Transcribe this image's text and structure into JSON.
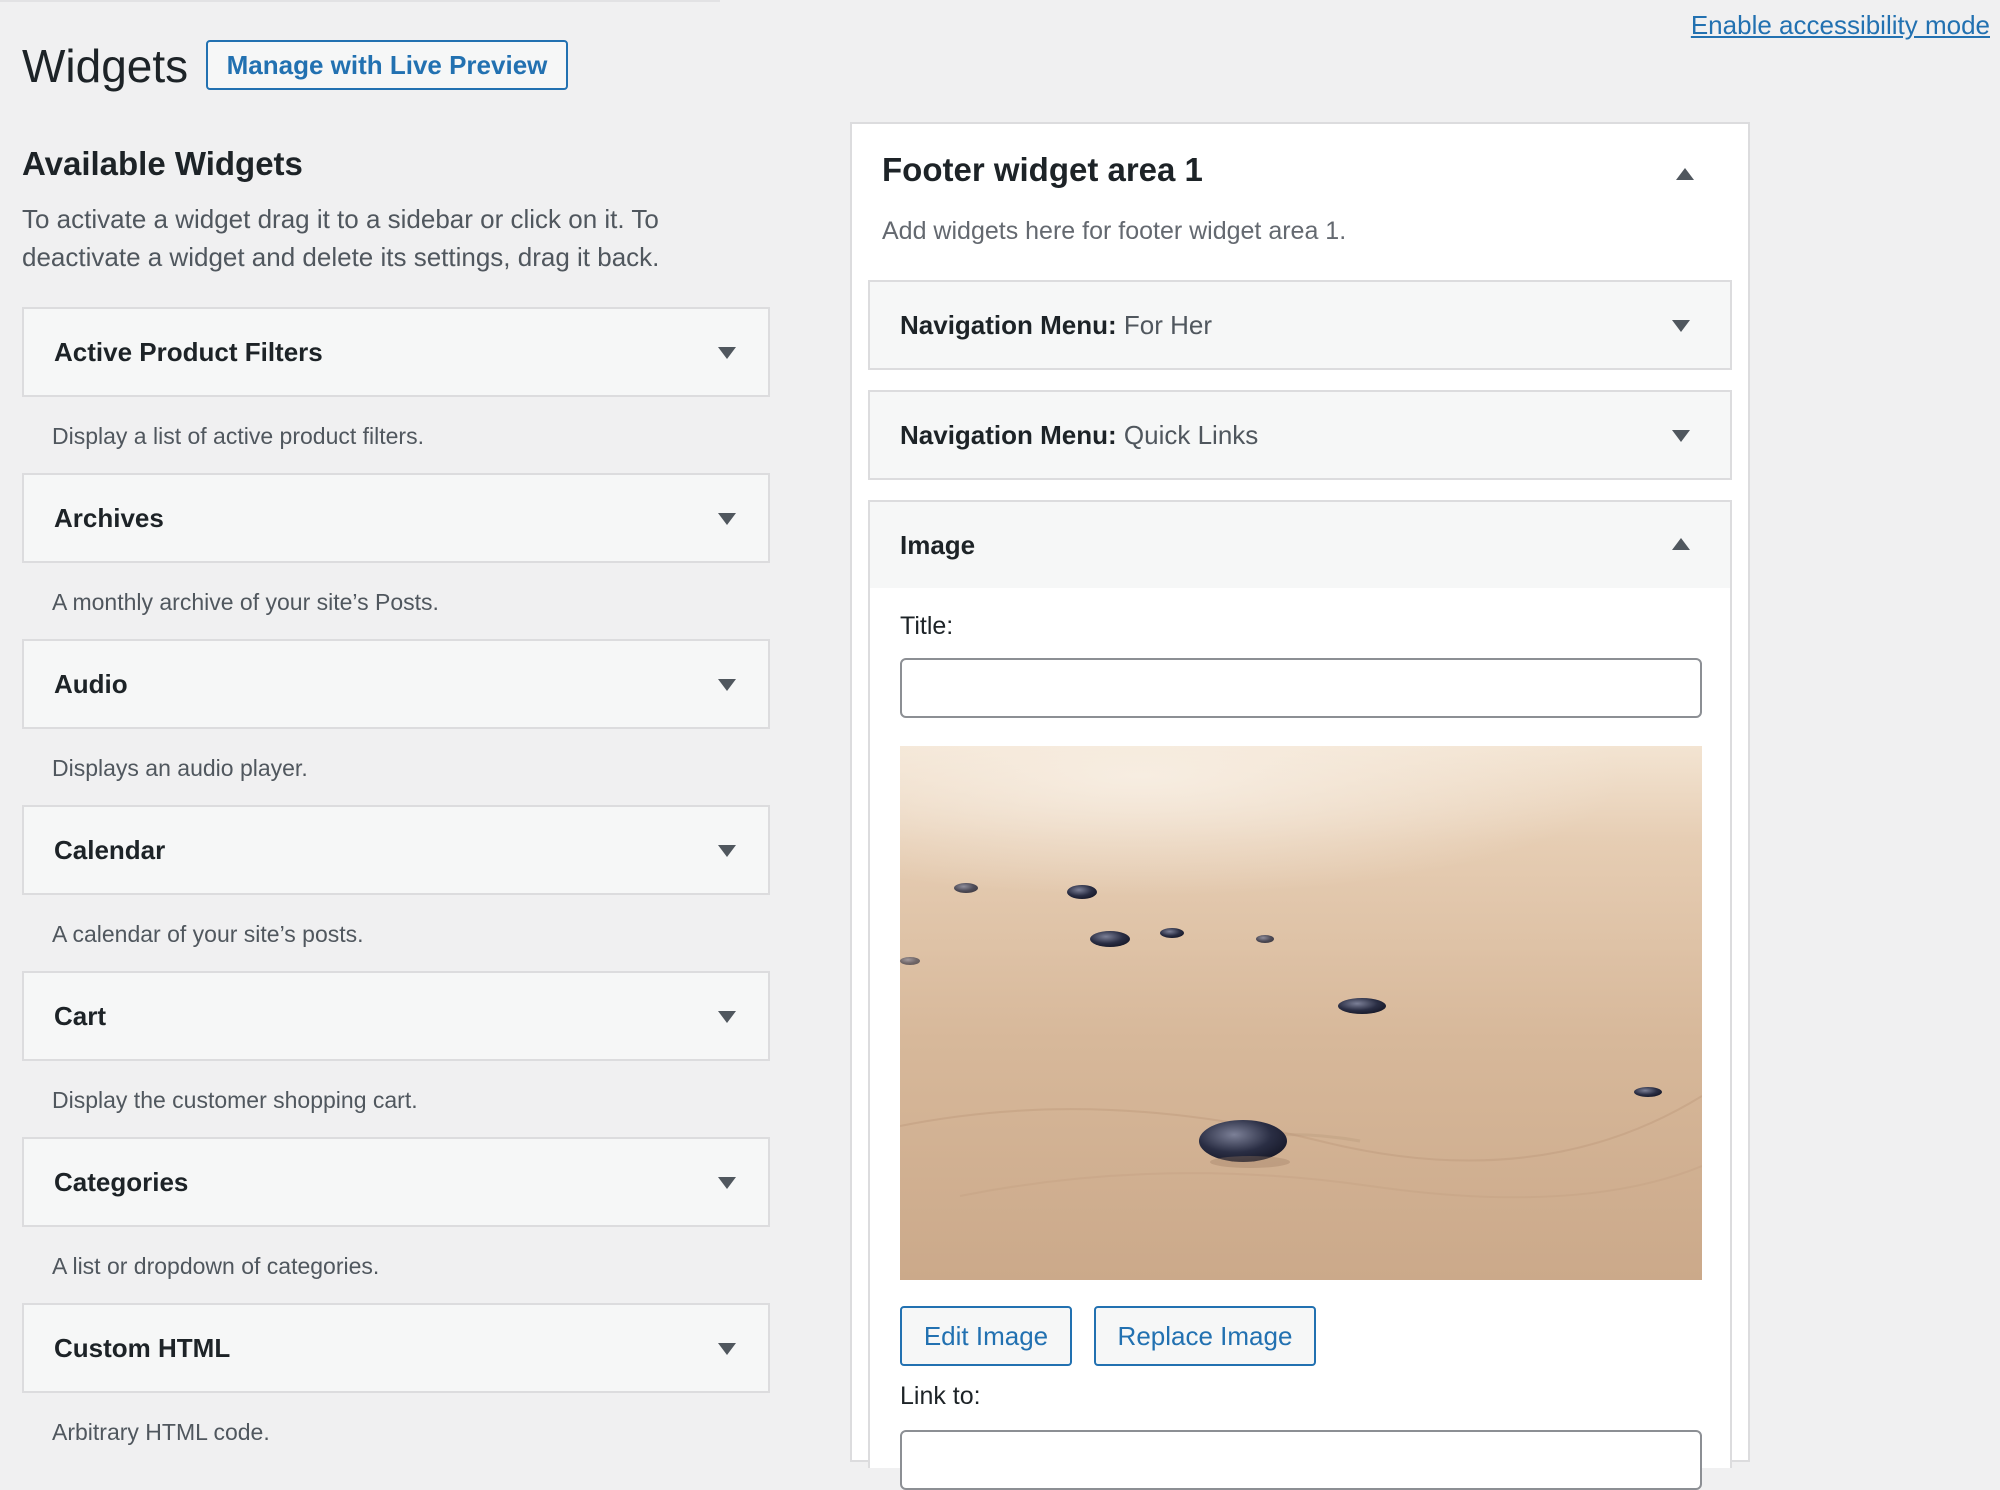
{
  "header": {
    "title": "Widgets",
    "live_preview_label": "Manage with Live Preview",
    "accessibility_link": "Enable accessibility mode"
  },
  "available": {
    "title": "Available Widgets",
    "description": "To activate a widget drag it to a sidebar or click on it. To deactivate a widget and delete its settings, drag it back.",
    "widgets": [
      {
        "name": "Active Product Filters",
        "description": "Display a list of active product filters."
      },
      {
        "name": "Archives",
        "description": "A monthly archive of your site’s Posts."
      },
      {
        "name": "Audio",
        "description": "Displays an audio player."
      },
      {
        "name": "Calendar",
        "description": "A calendar of your site’s posts."
      },
      {
        "name": "Cart",
        "description": "Display the customer shopping cart."
      },
      {
        "name": "Categories",
        "description": "A list or dropdown of categories."
      },
      {
        "name": "Custom HTML",
        "description": "Arbitrary HTML code."
      }
    ]
  },
  "sidebar": {
    "title": "Footer widget area 1",
    "description": "Add widgets here for footer widget area 1.",
    "widgets": [
      {
        "name": "Navigation Menu",
        "separator": ":",
        "instance_title": " For Her"
      },
      {
        "name": "Navigation Menu",
        "separator": ":",
        "instance_title": " Quick Links"
      },
      {
        "name": "Image"
      }
    ],
    "image_widget": {
      "title_label": "Title:",
      "title_value": "",
      "edit_button": "Edit Image",
      "replace_button": "Replace Image",
      "link_label": "Link to:"
    }
  },
  "colors": {
    "accent": "#2271b1",
    "background": "#f0f0f1",
    "panel": "#ffffff",
    "border": "#dcdcde"
  }
}
